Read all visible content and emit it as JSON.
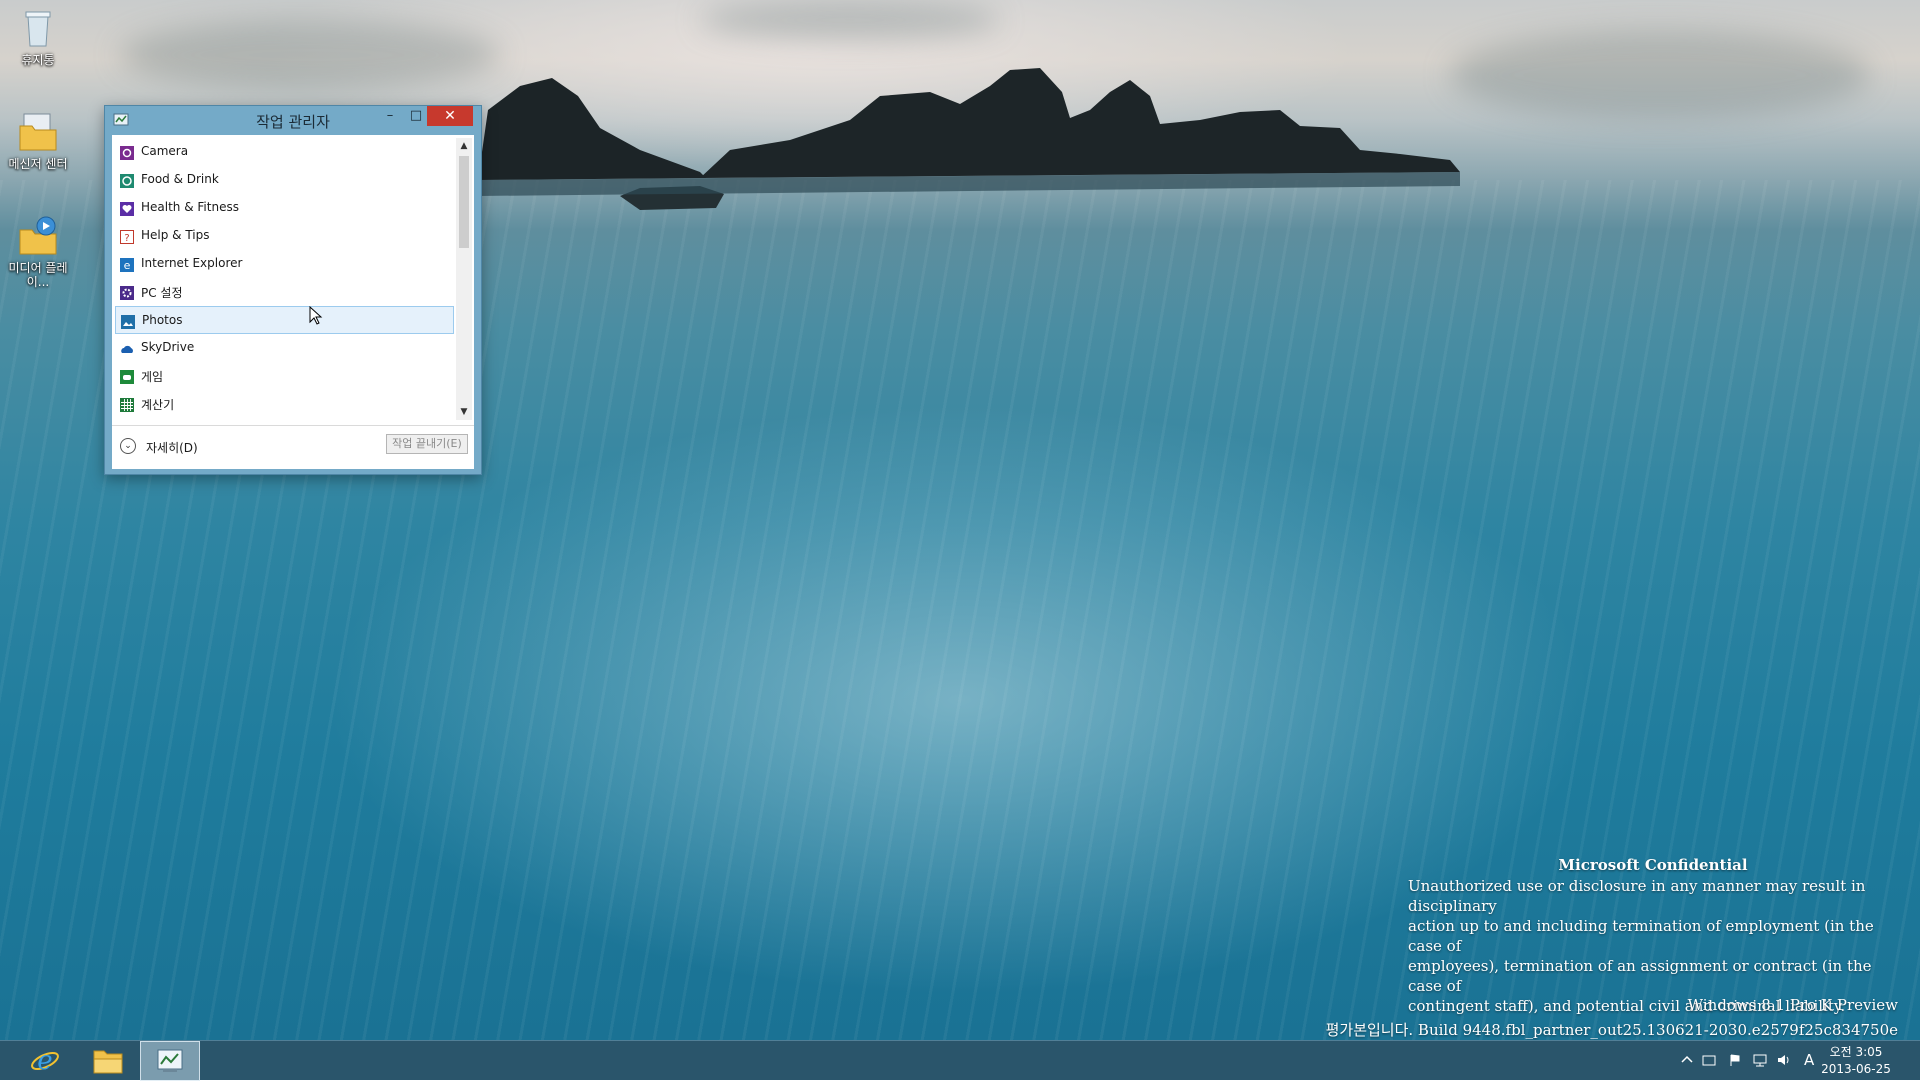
{
  "desktop": {
    "icons": [
      {
        "label": "휴지통",
        "icon": "recycle-bin-icon"
      },
      {
        "label": "메신저 센터",
        "icon": "folder-icon"
      },
      {
        "label": "미디어 플레이...",
        "icon": "media-player-icon"
      }
    ]
  },
  "task_manager": {
    "title": "작업 관리자",
    "controls": {
      "minimize": "–",
      "maximize": "□",
      "close": "✕"
    },
    "apps": [
      {
        "label": "Camera",
        "icon": "camera-icon",
        "color": "#7a2b8f"
      },
      {
        "label": "Food & Drink",
        "icon": "food-drink-icon",
        "color": "#1f8a70"
      },
      {
        "label": "Health & Fitness",
        "icon": "health-fitness-icon",
        "color": "#5b2ea6"
      },
      {
        "label": "Help & Tips",
        "icon": "help-tips-icon",
        "color": "#c0392b"
      },
      {
        "label": "Internet Explorer",
        "icon": "internet-explorer-icon",
        "color": "#1e73be"
      },
      {
        "label": "PC 설정",
        "icon": "pc-settings-icon",
        "color": "#4b2a8a"
      },
      {
        "label": "Photos",
        "icon": "photos-icon",
        "color": "#1f6fa8",
        "selected": true
      },
      {
        "label": "SkyDrive",
        "icon": "skydrive-icon",
        "color": "#1b5fb0"
      },
      {
        "label": "게임",
        "icon": "games-icon",
        "color": "#1e8a3a"
      },
      {
        "label": "계산기",
        "icon": "calculator-icon",
        "color": "#1e7a3a"
      }
    ],
    "details_label": "자세히(D)",
    "end_task_label": "작업 끝내기(E)"
  },
  "watermark": {
    "title": "Microsoft Confidential",
    "lines": [
      "Unauthorized use or disclosure in any manner may result in disciplinary",
      "action up to and including termination of employment (in the case of",
      "employees), termination of an assignment or contract (in the case of",
      "contingent staff), and potential civil and criminal liability."
    ],
    "edition": "Windows 8.1 Pro K Preview",
    "build": "평가본입니다. Build 9448.fbl_partner_out25.130621-2030.e2579f25c834750e"
  },
  "taskbar": {
    "pinned": [
      {
        "name": "internet-explorer",
        "icon": "internet-explorer-icon"
      },
      {
        "name": "file-explorer",
        "icon": "file-explorer-icon"
      },
      {
        "name": "task-manager",
        "icon": "task-manager-icon",
        "active": true
      }
    ],
    "tray": {
      "ime": "A"
    },
    "clock": {
      "time": "오전 3:05",
      "date": "2013-06-25"
    }
  }
}
